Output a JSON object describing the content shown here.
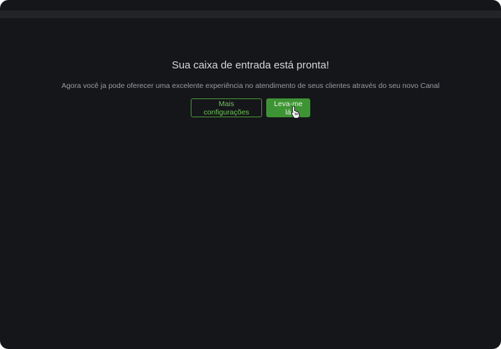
{
  "onboarding": {
    "title": "Sua caixa de entrada está pronta!",
    "subtitle": "Agora você ja pode oferecer uma excelente experiência no atendimento de seus clientes através do seu novo Canal",
    "more_settings_label": "Mais configurações",
    "take_me_label": "Leva-me lá"
  },
  "icons": {
    "cursor": "hand-pointer-icon"
  },
  "colors": {
    "background": "#151619",
    "accent": "#3e9435",
    "accent_text": "#6fc25b"
  }
}
